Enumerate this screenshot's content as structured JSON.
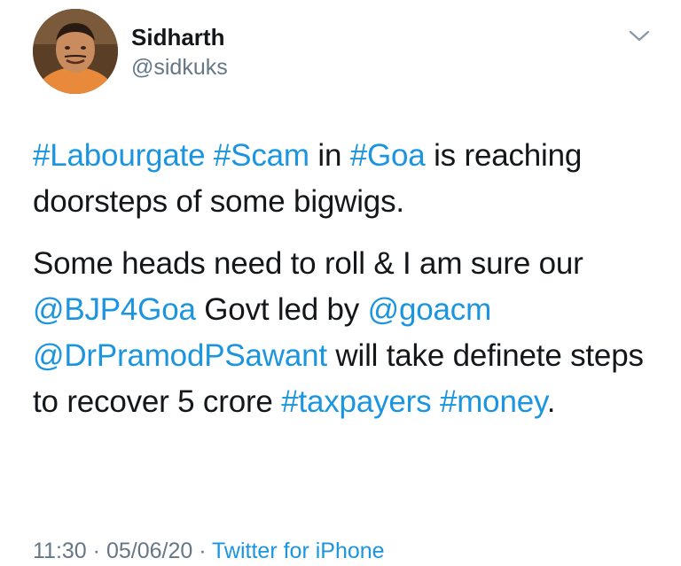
{
  "user": {
    "name": "Sidharth",
    "handle": "@sidkuks"
  },
  "icons": {
    "avatar": "profile-photo",
    "menu": "chevron-down-icon"
  },
  "tweet": {
    "p1": {
      "t1": "#Labourgate",
      "s1": " ",
      "t2": "#Scam",
      "s2": " in ",
      "t3": "#Goa",
      "s3": " is reaching doorsteps of some bigwigs."
    },
    "p2": {
      "s1": "Some heads need to roll & I am sure our ",
      "m1": "@BJP4Goa",
      "s2": " Govt led by ",
      "m2": "@goacm",
      "s3": " ",
      "m3": "@DrPramodPSawant",
      "s4": " will take definete steps to recover 5 crore ",
      "t1": "#taxpayers",
      "s5": " ",
      "t2": "#money",
      "s6": "."
    }
  },
  "meta": {
    "time": "11:30",
    "sep1": " · ",
    "date": "05/06/20",
    "sep2": " · ",
    "source": "Twitter for iPhone"
  },
  "colors": {
    "link": "#1b95e0",
    "text": "#14171a",
    "muted": "#657786"
  }
}
